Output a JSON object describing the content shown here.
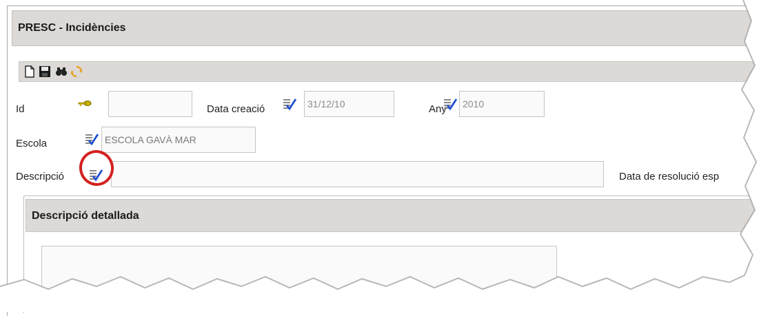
{
  "header": {
    "title": "PRESC - Incidències"
  },
  "toolbar": {
    "icons": [
      "new-document-icon",
      "save-icon",
      "find-icon",
      "refresh-icon"
    ]
  },
  "form": {
    "id": {
      "label": "Id",
      "value": ""
    },
    "data_creacio": {
      "label": "Data creació",
      "value": "31/12/10"
    },
    "any": {
      "label": "Any",
      "value": "2010"
    },
    "escola": {
      "label": "Escola",
      "value": "ESCOLA GAVÀ MAR"
    },
    "descripcio": {
      "label": "Descripció",
      "value": ""
    },
    "data_resolucio": {
      "label": "Data de resolució esp"
    }
  },
  "detail": {
    "title": "Descripció detallada",
    "value": ""
  },
  "colors": {
    "header_bg": "#dcd9d7",
    "check_blue": "#1f4fd0",
    "highlight_red": "#d42020",
    "key_yellow": "#c9b000"
  }
}
